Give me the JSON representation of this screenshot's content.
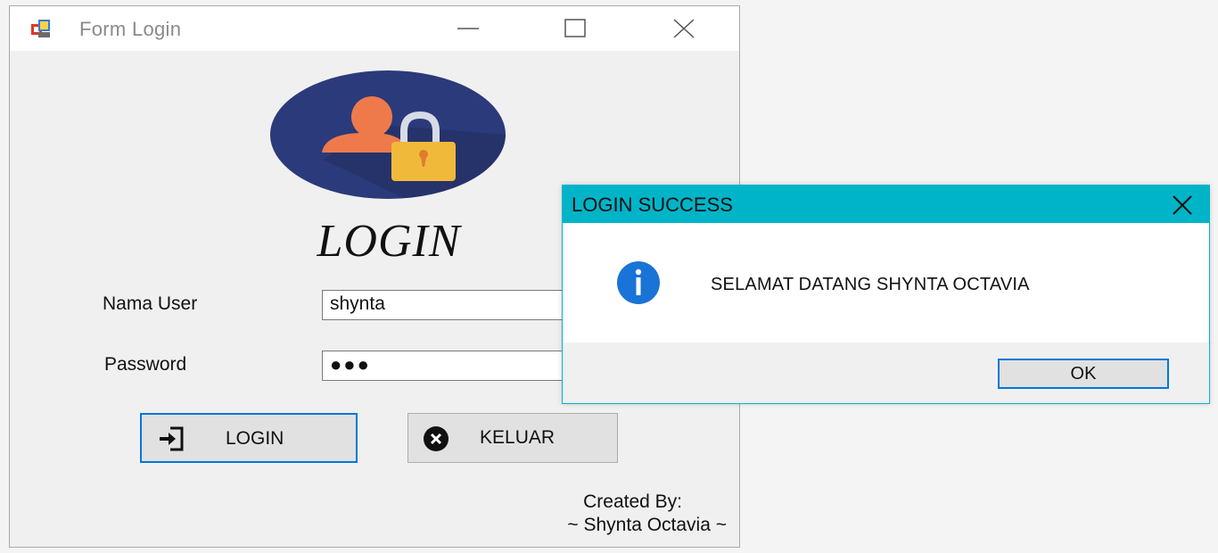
{
  "window": {
    "title": "Form Login",
    "icons": {
      "app": "app-icon",
      "minimize": "minimize-icon",
      "maximize": "maximize-icon",
      "close": "close-icon"
    }
  },
  "form": {
    "heading": "LOGIN",
    "logo_icon": "user-lock-icon",
    "username_label": "Nama User",
    "username_value": "shynta",
    "password_label": "Password",
    "password_value": "●●●",
    "login_button": "LOGIN",
    "login_icon": "sign-in-icon",
    "exit_button": "KELUAR",
    "exit_icon": "close-circle-icon",
    "credit_line1": "Created By:",
    "credit_line2": "~ Shynta Octavia ~"
  },
  "dialog": {
    "title": "LOGIN SUCCESS",
    "message": "SELAMAT DATANG SHYNTA OCTAVIA",
    "ok_label": "OK",
    "info_icon": "info-icon",
    "accent_color": "#00b4c8"
  },
  "colors": {
    "focus_border": "#0078d7",
    "window_bg": "#f0f0f0",
    "logo_circle": "#2b3a7a",
    "lock": "#f0b93a",
    "person": "#ee7a4c"
  }
}
